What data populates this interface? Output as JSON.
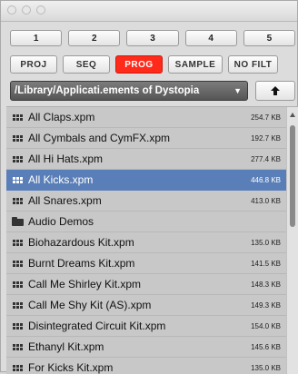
{
  "numbers": [
    "1",
    "2",
    "3",
    "4",
    "5"
  ],
  "modes": [
    {
      "label": "PROJ",
      "active": false
    },
    {
      "label": "SEQ",
      "active": false
    },
    {
      "label": "PROG",
      "active": true
    },
    {
      "label": "SAMPLE",
      "active": false
    },
    {
      "label": "NO FILT",
      "active": false
    }
  ],
  "path": "/Library/Applicati.ements of Dystopia",
  "path_caret": "▼",
  "up_icon": "up-arrow-icon",
  "files": [
    {
      "name": "All Claps.xpm",
      "size": "254.7 KB",
      "type": "file",
      "selected": false
    },
    {
      "name": "All Cymbals and CymFX.xpm",
      "size": "192.7 KB",
      "type": "file",
      "selected": false
    },
    {
      "name": "All Hi Hats.xpm",
      "size": "277.4 KB",
      "type": "file",
      "selected": false
    },
    {
      "name": "All Kicks.xpm",
      "size": "446.8 KB",
      "type": "file",
      "selected": true
    },
    {
      "name": "All Snares.xpm",
      "size": "413.0 KB",
      "type": "file",
      "selected": false
    },
    {
      "name": "Audio Demos",
      "size": "",
      "type": "folder",
      "selected": false
    },
    {
      "name": "Biohazardous Kit.xpm",
      "size": "135.0 KB",
      "type": "file",
      "selected": false
    },
    {
      "name": "Burnt Dreams Kit.xpm",
      "size": "141.5 KB",
      "type": "file",
      "selected": false
    },
    {
      "name": "Call Me Shirley Kit.xpm",
      "size": "148.3 KB",
      "type": "file",
      "selected": false
    },
    {
      "name": "Call Me Shy Kit (AS).xpm",
      "size": "149.3 KB",
      "type": "file",
      "selected": false
    },
    {
      "name": "Disintegrated Circuit Kit.xpm",
      "size": "154.0 KB",
      "type": "file",
      "selected": false
    },
    {
      "name": "Ethanyl Kit.xpm",
      "size": "145.6 KB",
      "type": "file",
      "selected": false
    },
    {
      "name": "For Kicks Kit.xpm",
      "size": "135.0 KB",
      "type": "file",
      "selected": false
    }
  ],
  "colors": {
    "active_mode": "#ff2a1a",
    "selection": "#5a7fb8"
  }
}
